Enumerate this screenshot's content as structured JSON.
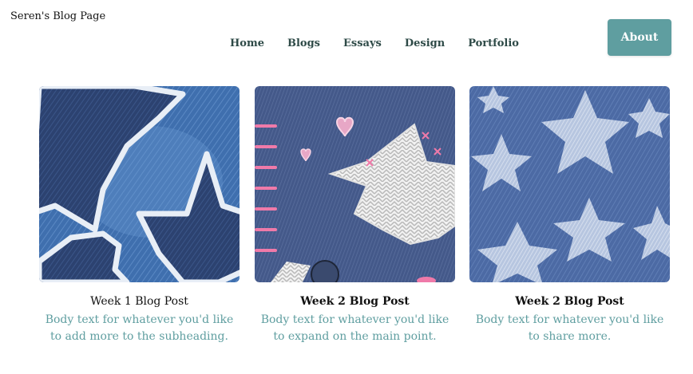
{
  "header": {
    "site_title": "Seren's Blog Page",
    "about_label": "About"
  },
  "nav": {
    "items": [
      {
        "label": "Home"
      },
      {
        "label": "Blogs"
      },
      {
        "label": "Essays"
      },
      {
        "label": "Design"
      },
      {
        "label": "Portfolio"
      }
    ]
  },
  "cards": [
    {
      "title": "Week 1 Blog Post",
      "body_line1": "Body text for whatever you'd like",
      "body_line2": "to add more to the subheading.",
      "image": "denim-patch-stars-image"
    },
    {
      "title": "Week 2 Blog Post",
      "body_line1": "Body text for whatever you'd like",
      "body_line2": "to expand on the main point.",
      "image": "denim-knit-star-hearts-image"
    },
    {
      "title": "Week 2 Blog Post",
      "body_line1": "Body text for whatever you'd like",
      "body_line2": "to share more.",
      "image": "denim-faded-stars-image"
    }
  ],
  "colors": {
    "accent": "#5f9ea0",
    "nav_text": "#2e4a47",
    "denim_light": "#4a7bb7",
    "denim_dark": "#2f4a7a"
  }
}
